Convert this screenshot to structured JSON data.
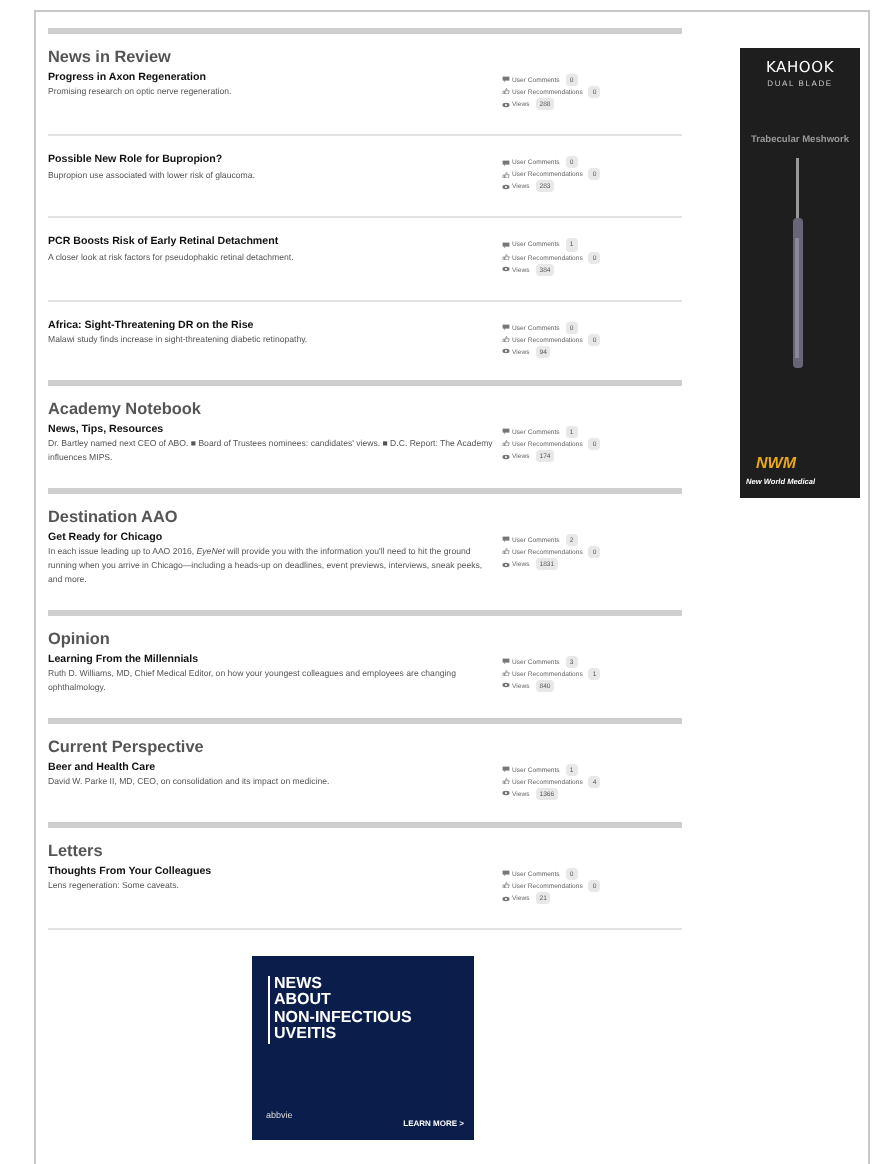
{
  "sections": [
    {
      "heading": "News in Review",
      "items": [
        {
          "title": "Progress in Axon Regeneration",
          "summary": "Promising research on optic nerve regeneration.",
          "comments_label": "User Comments",
          "comments": "0",
          "recommendations_label": "User Recommendations",
          "recommendations": "0",
          "views_label": "Views",
          "views": "288"
        },
        {
          "title": "Possible New Role for Bupropion?",
          "summary": "Bupropion use associated with lower risk of glaucoma.",
          "comments_label": "User Comments",
          "comments": "0",
          "recommendations_label": "User Recommendations",
          "recommendations": "0",
          "views_label": "Views",
          "views": "283"
        },
        {
          "title": "PCR Boosts Risk of Early Retinal Detachment",
          "summary": "A closer look at risk factors for pseudophakic retinal detachment.",
          "comments_label": "User Comments",
          "comments": "1",
          "recommendations_label": "User Recommendations",
          "recommendations": "0",
          "views_label": "Views",
          "views": "384"
        },
        {
          "title": "Africa: Sight-Threatening DR on the Rise",
          "summary": "Malawi study finds increase in sight-threatening diabetic retinopathy.",
          "comments_label": "User Comments",
          "comments": "0",
          "recommendations_label": "User Recommendations",
          "recommendations": "0",
          "views_label": "Views",
          "views": "94"
        }
      ]
    },
    {
      "heading": "Academy Notebook",
      "items": [
        {
          "title": "News, Tips, Resources",
          "summary": "Dr. Bartley named next CEO of ABO. ■ Board of Trustees nominees: candidates' views. ■ D.C. Report: The Academy influences MIPS.",
          "comments_label": "User Comments",
          "comments": "1",
          "recommendations_label": "User Recommendations",
          "recommendations": "0",
          "views_label": "Views",
          "views": "174"
        }
      ]
    },
    {
      "heading": "Destination AAO",
      "items": [
        {
          "title": "Get Ready for Chicago",
          "summary": "In each issue leading up to AAO 2016, *EyeNet* will provide you with the information you'll need to hit the ground running when you arrive in Chicago—including a heads-up on deadlines, event previews, interviews, sneak peeks, and more.",
          "comments_label": "User Comments",
          "comments": "2",
          "recommendations_label": "User Recommendations",
          "recommendations": "0",
          "views_label": "Views",
          "views": "1831"
        }
      ]
    },
    {
      "heading": "Opinion",
      "items": [
        {
          "title": "Learning From the Millennials",
          "summary": "Ruth D. Williams, MD, Chief Medical Editor, on how your youngest colleagues and employees are changing ophthalmology.",
          "comments_label": "User Comments",
          "comments": "3",
          "recommendations_label": "User Recommendations",
          "recommendations": "1",
          "views_label": "Views",
          "views": "840"
        }
      ]
    },
    {
      "heading": "Current Perspective",
      "items": [
        {
          "title": "Beer and Health Care",
          "summary": "David W. Parke II, MD, CEO, on consolidation and its impact on medicine.",
          "comments_label": "User Comments",
          "comments": "1",
          "recommendations_label": "User Recommendations",
          "recommendations": "4",
          "views_label": "Views",
          "views": "1366"
        }
      ]
    },
    {
      "heading": "Letters",
      "items": [
        {
          "title": "Thoughts From Your Colleagues",
          "summary": "Lens regeneration: Some caveats.",
          "comments_label": "User Comments",
          "comments": "0",
          "recommendations_label": "User Recommendations",
          "recommendations": "0",
          "views_label": "Views",
          "views": "21"
        }
      ]
    }
  ],
  "side_ad": {
    "brand": "KAHOOK",
    "tagline": "DUAL BLADE",
    "feature": "Trabecular Meshwork",
    "maker": "NWM",
    "maker_name": "New World Medical"
  },
  "bottom_ad": {
    "headline": [
      "NEWS",
      "ABOUT",
      "NON-INFECTIOUS",
      "UVEITIS"
    ],
    "sponsor": "abbvie",
    "cta": "LEARN MORE >"
  }
}
